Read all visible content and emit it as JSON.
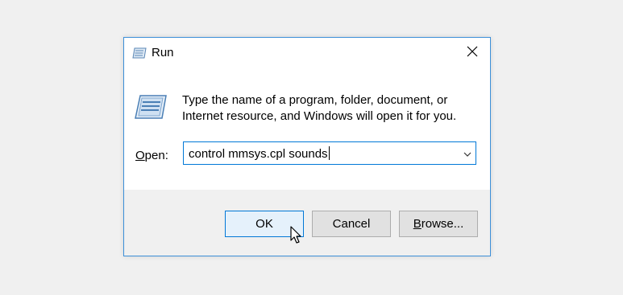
{
  "window": {
    "title": "Run",
    "icon": "run-icon",
    "close_icon": "close-icon"
  },
  "content": {
    "message_line1": "Type the name of a program, folder, document, or",
    "message_line2": "Internet resource, and Windows will open it for you.",
    "open_label_accel": "O",
    "open_label_rest": "pen:",
    "open_value": "control mmsys.cpl sounds",
    "dropdown_icon": "chevron-down-icon"
  },
  "buttons": {
    "ok": "OK",
    "cancel": "Cancel",
    "browse_accel": "B",
    "browse_rest": "rowse..."
  },
  "colors": {
    "accent": "#0078d7",
    "window_border": "#3c8fd8",
    "ok_button_bg": "#e5f1fb"
  }
}
